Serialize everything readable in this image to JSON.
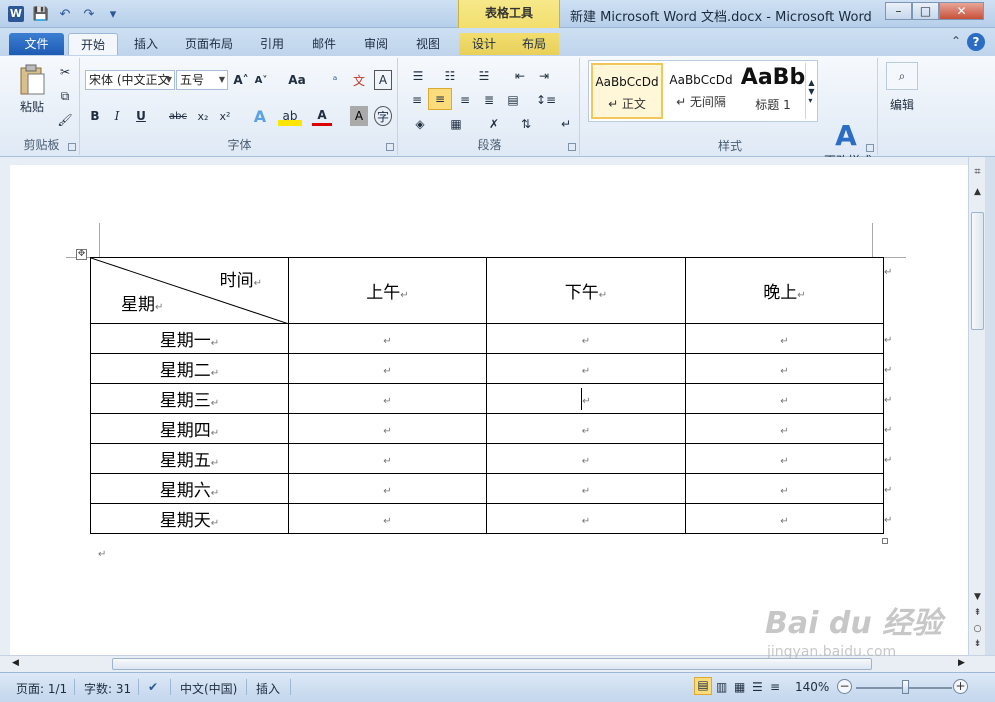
{
  "window": {
    "title": "新建 Microsoft Word 文档.docx - Microsoft Word",
    "app_icon": "W",
    "contextual_group": "表格工具"
  },
  "qat": {
    "save_icon": "💾",
    "undo_icon": "↶",
    "redo_icon": "↷",
    "customize_icon": "▾"
  },
  "tabs": {
    "file": "文件",
    "items": [
      "开始",
      "插入",
      "页面布局",
      "引用",
      "邮件",
      "审阅",
      "视图"
    ],
    "context_items": [
      "设计",
      "布局"
    ]
  },
  "ribbon": {
    "clipboard": {
      "paste": "粘贴",
      "label": "剪贴板"
    },
    "font": {
      "face": "宋体 (中文正文",
      "size": "五号",
      "label": "字体",
      "grow": "A˄",
      "shrink": "A˅",
      "change_case": "Aa",
      "bold": "B",
      "italic": "I",
      "underline": "U",
      "strike": "abc",
      "subscript": "x₂",
      "superscript": "x²",
      "font_color": "A",
      "char_shading": "A",
      "enclose": "字"
    },
    "paragraph": {
      "label": "段落"
    },
    "styles": {
      "label": "样式",
      "items": [
        {
          "sample": "AaBbCcDd",
          "name": "↵ 正文"
        },
        {
          "sample": "AaBbCcDd",
          "name": "↵ 无间隔"
        },
        {
          "sample": "AaBb",
          "name": "标题 1"
        }
      ],
      "change": "更改样式"
    },
    "editing": {
      "label": "编辑"
    }
  },
  "table": {
    "diag_top": "时间",
    "diag_bottom": "星期",
    "headers": [
      "上午",
      "下午",
      "晚上"
    ],
    "rows": [
      "星期一",
      "星期二",
      "星期三",
      "星期四",
      "星期五",
      "星期六",
      "星期天"
    ],
    "para_mark": "↵"
  },
  "statusbar": {
    "page": "页面: 1/1",
    "words": "字数: 31",
    "language": "中文(中国)",
    "mode": "插入",
    "zoom": "140%"
  },
  "watermark": {
    "big": "Bai du 经验",
    "small": "jingyan.baidu.com"
  }
}
